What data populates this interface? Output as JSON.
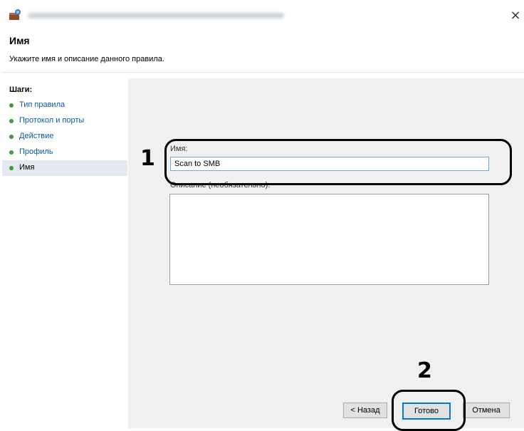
{
  "window": {
    "close_glyph": "×",
    "icon": "firewall-wizard-icon"
  },
  "header": {
    "title": "Имя",
    "subtitle": "Укажите имя и описание данного правила."
  },
  "steps": {
    "title": "Шаги:",
    "items": [
      {
        "label": "Тип правила",
        "current": false
      },
      {
        "label": "Протокол и порты",
        "current": false
      },
      {
        "label": "Действие",
        "current": false
      },
      {
        "label": "Профиль",
        "current": false
      },
      {
        "label": "Имя",
        "current": true
      }
    ]
  },
  "form": {
    "name_label": "Имя:",
    "name_value": "Scan to SMB",
    "description_label": "Описание (необязательно):",
    "description_value": ""
  },
  "buttons": {
    "back": "< Назад",
    "finish": "Готово",
    "cancel": "Отмена"
  },
  "callouts": {
    "one": "1",
    "two": "2"
  },
  "colors": {
    "step_dot": "#3d9a3d",
    "link": "#0b57a7",
    "input_border": "#7aa7da",
    "focus": "#0078d7"
  }
}
